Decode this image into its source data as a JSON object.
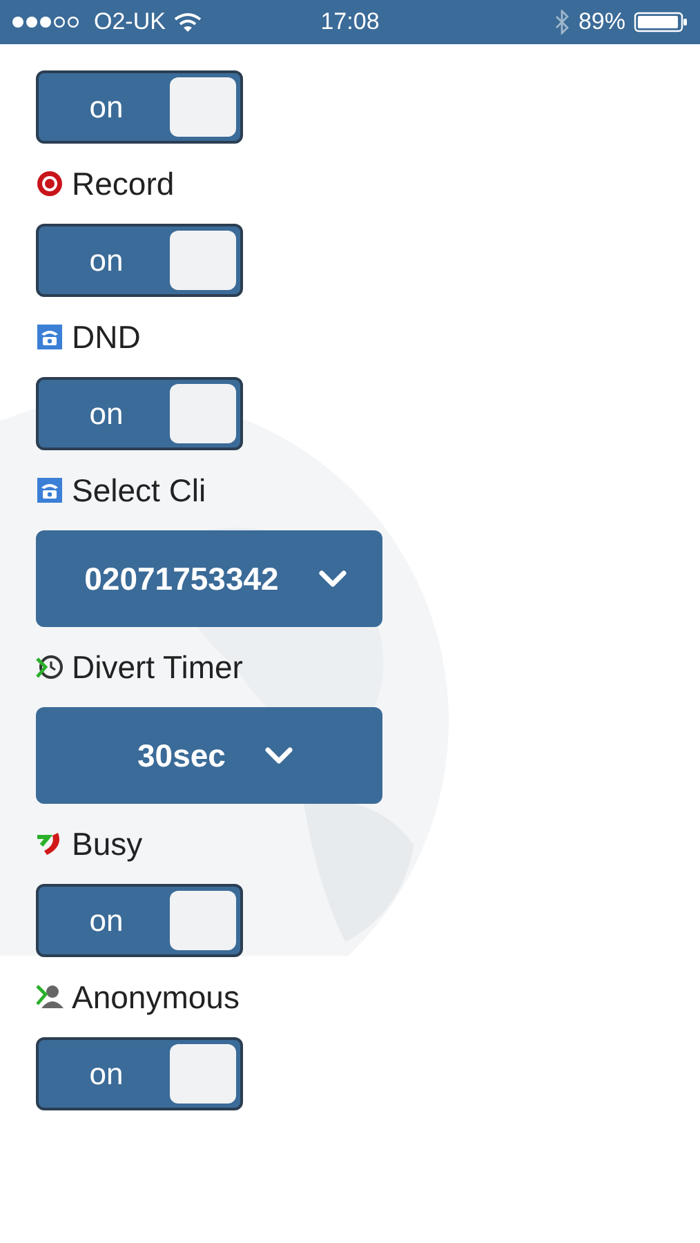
{
  "status_bar": {
    "carrier": "O2-UK",
    "time": "17:08",
    "battery": "89%"
  },
  "items": [
    {
      "kind": "toggle",
      "text": "on",
      "on": true
    },
    {
      "kind": "label",
      "text": "Record"
    },
    {
      "kind": "toggle",
      "text": "on",
      "on": true
    },
    {
      "kind": "label",
      "text": "DND"
    },
    {
      "kind": "toggle",
      "text": "on",
      "on": true
    },
    {
      "kind": "label",
      "text": "Select Cli"
    },
    {
      "kind": "select",
      "text": "02071753342"
    },
    {
      "kind": "label",
      "text": "Divert Timer"
    },
    {
      "kind": "select",
      "text": "30sec"
    },
    {
      "kind": "label",
      "text": "Busy"
    },
    {
      "kind": "toggle",
      "text": "on",
      "on": true
    },
    {
      "kind": "label",
      "text": "Anonymous"
    },
    {
      "kind": "toggle",
      "text": "on",
      "on": true
    }
  ]
}
